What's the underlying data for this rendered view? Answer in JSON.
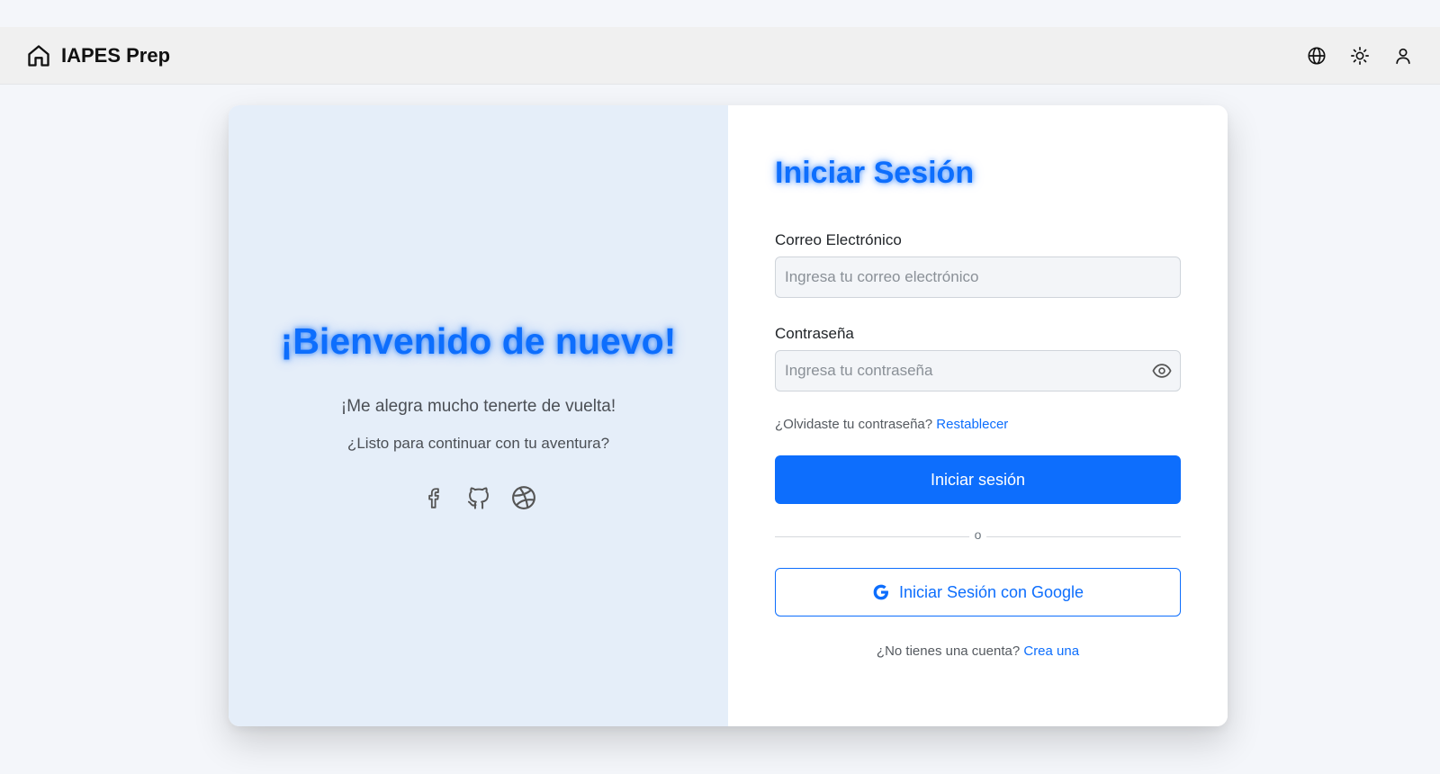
{
  "navbar": {
    "brand": "IAPES Prep",
    "icons": [
      "home-icon",
      "globe-icon",
      "sun-icon",
      "user-icon"
    ]
  },
  "left_panel": {
    "welcome": "¡Bienvenido de nuevo!",
    "subtitle": "¡Me alegra mucho tenerte de vuelta!",
    "tagline": "¿Listo para continuar con tu aventura?",
    "social_icons": [
      "facebook-icon",
      "github-icon",
      "dribbble-icon"
    ]
  },
  "login": {
    "title": "Iniciar Sesión",
    "email_label": "Correo Electrónico",
    "email_placeholder": "Ingresa tu correo electrónico",
    "email_value": "",
    "password_label": "Contraseña",
    "password_placeholder": "Ingresa tu contraseña",
    "password_value": "",
    "forgot_text": "¿Olvidaste tu contraseña?",
    "forgot_link": "Restablecer",
    "submit_label": "Iniciar sesión",
    "divider_text": "o",
    "google_label": "Iniciar Sesión con Google",
    "signup_text": "¿No tienes una cuenta?",
    "signup_link": "Crea una"
  },
  "colors": {
    "primary": "#0d6efd",
    "left_panel_bg": "#e5eef9",
    "navbar_bg": "#f0f0f0",
    "page_bg": "#f4f6fa"
  }
}
